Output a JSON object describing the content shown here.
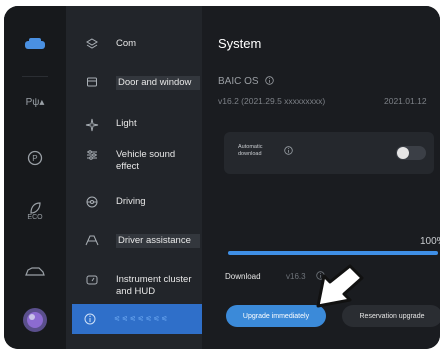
{
  "rail": {
    "items": [
      {
        "icon": "car-icon",
        "label": ""
      },
      {
        "icon": "park-assist-icon",
        "label": "Pψ▴"
      },
      {
        "icon": "parking-icon",
        "label": ""
      },
      {
        "icon": "eco-leaf-icon",
        "label": "ECO"
      },
      {
        "icon": "car-outline-icon",
        "label": ""
      },
      {
        "icon": "avatar",
        "label": ""
      }
    ]
  },
  "menu": {
    "items": [
      {
        "icon": "layers-icon",
        "label": "Com"
      },
      {
        "icon": "door-icon",
        "label": "Door and window"
      },
      {
        "icon": "light-icon",
        "label": "Light"
      },
      {
        "icon": "sound-icon",
        "label": "Vehicle sound effect"
      },
      {
        "icon": "steering-wheel-icon",
        "label": "Driving"
      },
      {
        "icon": "driver-assist-icon",
        "label": "Driver assistance"
      },
      {
        "icon": "gauge-icon",
        "label": "Instrument cluster and HUD"
      },
      {
        "icon": "info-icon",
        "label": "⩿⩿⩿⩿⩿⩿⩿"
      }
    ]
  },
  "system": {
    "title": "System",
    "os_name": "BAIC OS",
    "os_version": "v16.2 (2021.29.5 xxxxxxxxx)",
    "os_date": "2021.01.12",
    "auto_download_label": "Automatic download",
    "auto_download_enabled": true,
    "progress_percent": 100,
    "progress_label": "100%",
    "download_label": "Download",
    "download_version": "v16.3",
    "upgrade_button": "Upgrade immediately",
    "reservation_button": "Reservation upgrade"
  },
  "colors": {
    "accent": "#3b8ad9",
    "active_menu": "#2f6fc9",
    "background": "#111316"
  }
}
